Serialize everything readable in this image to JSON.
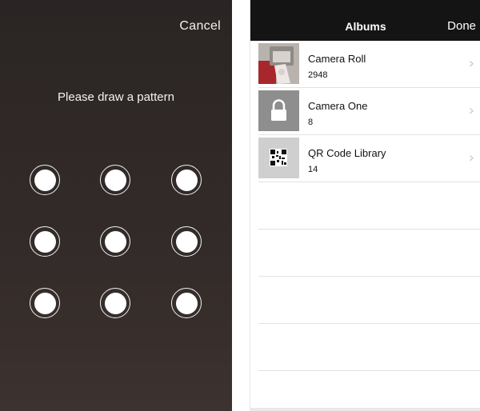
{
  "pattern_screen": {
    "cancel_label": "Cancel",
    "prompt": "Please draw a pattern",
    "dots": 9
  },
  "albums_screen": {
    "title": "Albums",
    "done_label": "Done",
    "albums": [
      {
        "name": "Camera Roll",
        "count": "2948",
        "thumb_icon": "photo-thumbnail"
      },
      {
        "name": "Camera One",
        "count": "8",
        "thumb_icon": "lock-icon"
      },
      {
        "name": "QR Code Library",
        "count": "14",
        "thumb_icon": "qr-code-thumbnail"
      }
    ]
  },
  "colors": {
    "lock_bg_top": "#2a2524",
    "lock_bg_bottom": "#3c322f",
    "navbar_bg": "#141414",
    "chevron": "#c7c7cc",
    "divider": "#e2e2e2"
  }
}
